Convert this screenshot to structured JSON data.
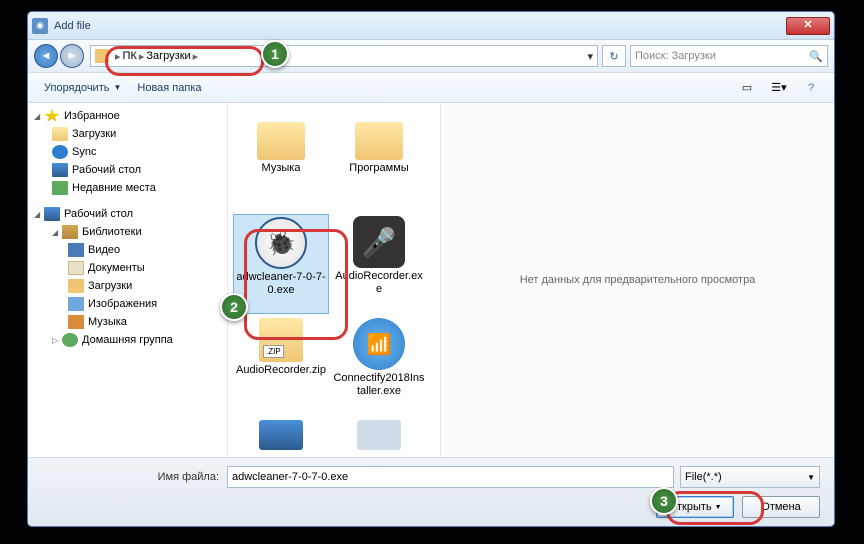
{
  "title": "Add file",
  "breadcrumb": {
    "a": "ПК",
    "b": "Загрузки"
  },
  "search_placeholder": "Поиск: Загрузки",
  "toolbar": {
    "organize": "Упорядочить",
    "newfolder": "Новая папка"
  },
  "sidebar": {
    "fav": "Избранное",
    "downloads": "Загрузки",
    "sync": "Sync",
    "desktop": "Рабочий стол",
    "recent": "Недавние места",
    "desktop2": "Рабочий стол",
    "libs": "Библиотеки",
    "video": "Видео",
    "docs": "Документы",
    "dl2": "Загрузки",
    "images": "Изображения",
    "music": "Музыка",
    "homegroup": "Домашняя группа"
  },
  "files": {
    "f1": "Музыка",
    "f2": "Программы",
    "f3": "adwcleaner-7-0-7-0.exe",
    "f4": "AudioRecorder.exe",
    "f5": "AudioRecorder.zip",
    "f6": "Connectify2018Installer.exe"
  },
  "preview_empty": "Нет данных для предварительного просмотра",
  "filename_label": "Имя файла:",
  "filename_value": "adwcleaner-7-0-7-0.exe",
  "filter": "File(*.*)",
  "open": "Открыть",
  "cancel": "Отмена",
  "badges": {
    "b1": "1",
    "b2": "2",
    "b3": "3"
  }
}
